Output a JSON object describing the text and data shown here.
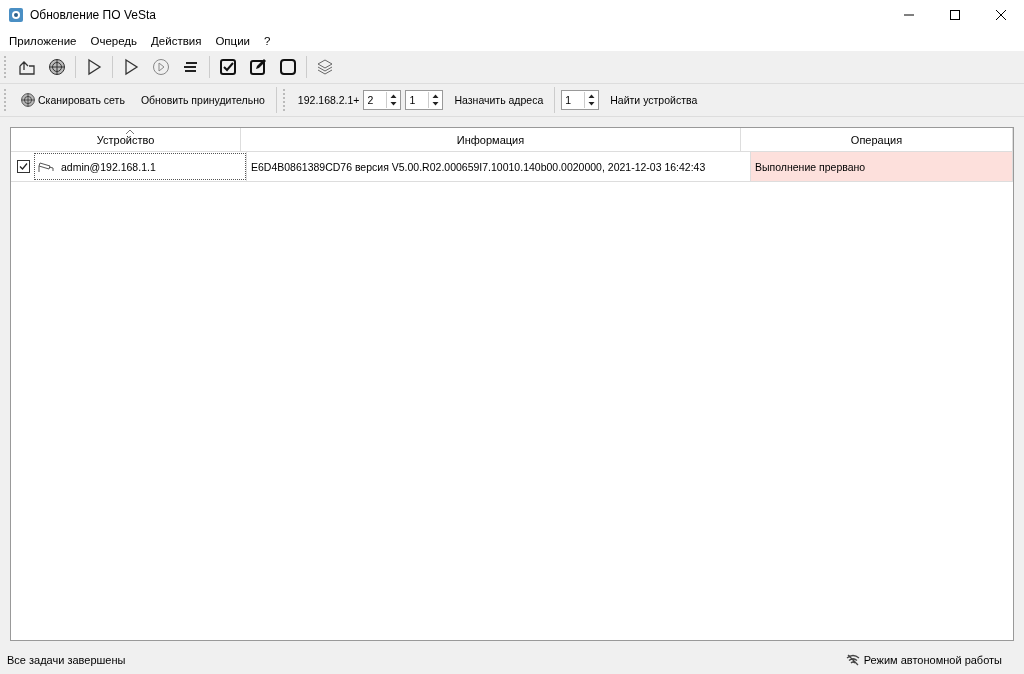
{
  "window": {
    "title": "Обновление ПО VeSta"
  },
  "menu": [
    "Приложение",
    "Очередь",
    "Действия",
    "Опции",
    "?"
  ],
  "network_toolbar": {
    "scan_button": "Сканировать сеть",
    "force_update_button": "Обновить принудительно",
    "address_prefix": "192.168.2.1+",
    "address_step": "2",
    "address_count": "1",
    "assign_button": "Назначить адреса",
    "find_count": "1",
    "find_button": "Найти устройства"
  },
  "table": {
    "columns": [
      {
        "title": "Устройство",
        "sorted": true
      },
      {
        "title": "Информация",
        "sorted": false
      },
      {
        "title": "Операция",
        "sorted": false
      }
    ],
    "rows": [
      {
        "checked": true,
        "device": "admin@192.168.1.1",
        "focused": true,
        "info": "E6D4B0861389CD76 версия V5.00.R02.000659I7.10010.140b00.0020000, 2021-12-03 16:42:43",
        "operation": "Выполнение прервано",
        "highlighted": true
      }
    ]
  },
  "status_bar": {
    "message": "Все задачи завершены",
    "mode": "Режим автономной работы"
  }
}
